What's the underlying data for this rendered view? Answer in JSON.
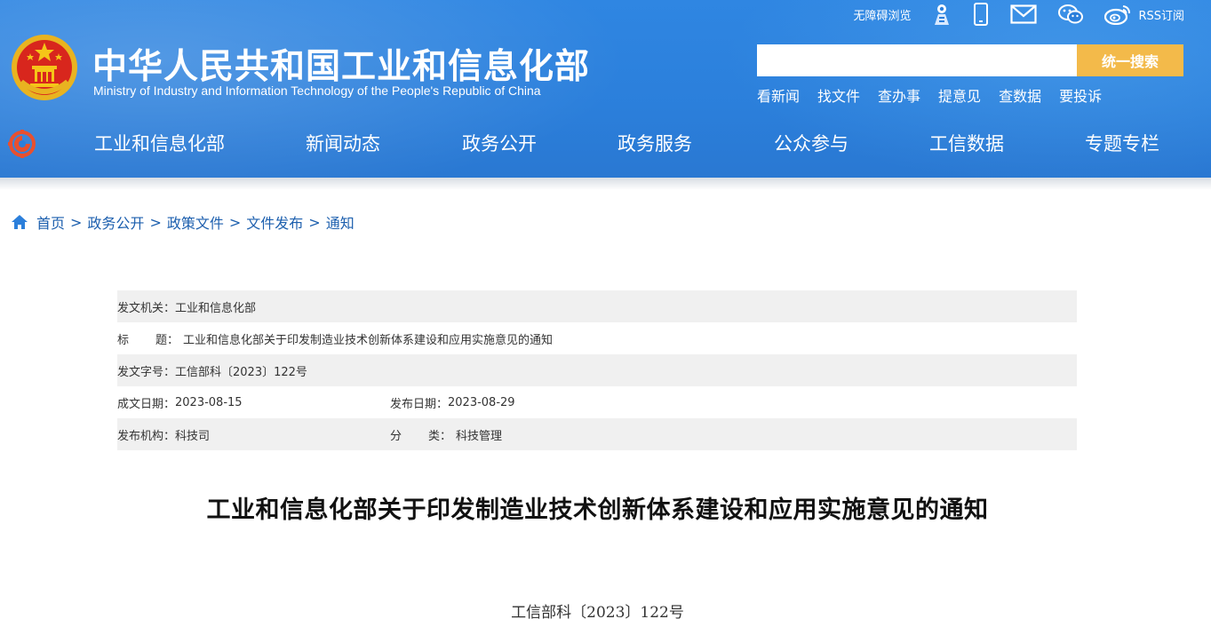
{
  "header": {
    "title": "中华人民共和国工业和信息化部",
    "subtitle": "Ministry of Industry and Information Technology of the People's Republic of China",
    "accessibility_label": "无障碍浏览",
    "rss_label": "RSS订阅",
    "icons": [
      "person-icon",
      "mobile-icon",
      "mail-icon",
      "wechat-icon",
      "weibo-icon"
    ],
    "search": {
      "placeholder": "",
      "button_label": "统一搜索"
    },
    "quick_links": [
      "看新闻",
      "找文件",
      "查办事",
      "提意见",
      "查数据",
      "要投诉"
    ]
  },
  "nav": {
    "items": [
      "工业和信息化部",
      "新闻动态",
      "政务公开",
      "政务服务",
      "公众参与",
      "工信数据",
      "专题专栏"
    ]
  },
  "breadcrumb": {
    "items": [
      "首页",
      "政务公开",
      "政策文件",
      "文件发布",
      "通知"
    ],
    "separator": ">"
  },
  "meta": {
    "issuer_label": "发文机关：",
    "issuer": "工业和信息化部",
    "title_label_a": "标",
    "title_label_b": "题：",
    "title": "工业和信息化部关于印发制造业技术创新体系建设和应用实施意见的通知",
    "doc_no_label": "发文字号：",
    "doc_no": "工信部科〔2023〕122号",
    "written_date_label": "成文日期：",
    "written_date": "2023-08-15",
    "publish_date_label": "发布日期：",
    "publish_date": "2023-08-29",
    "org_label": "发布机构：",
    "org": "科技司",
    "category_label_a": "分",
    "category_label_b": "类：",
    "category": "科技管理"
  },
  "document": {
    "title": "工业和信息化部关于印发制造业技术创新体系建设和应用实施意见的通知",
    "number": "工信部科〔2023〕122号"
  },
  "colors": {
    "header_blue": "#2b7fdb",
    "search_button": "#f3ba4a",
    "link_blue": "#1c5fae",
    "meta_row_gray": "#f0f0f0"
  }
}
